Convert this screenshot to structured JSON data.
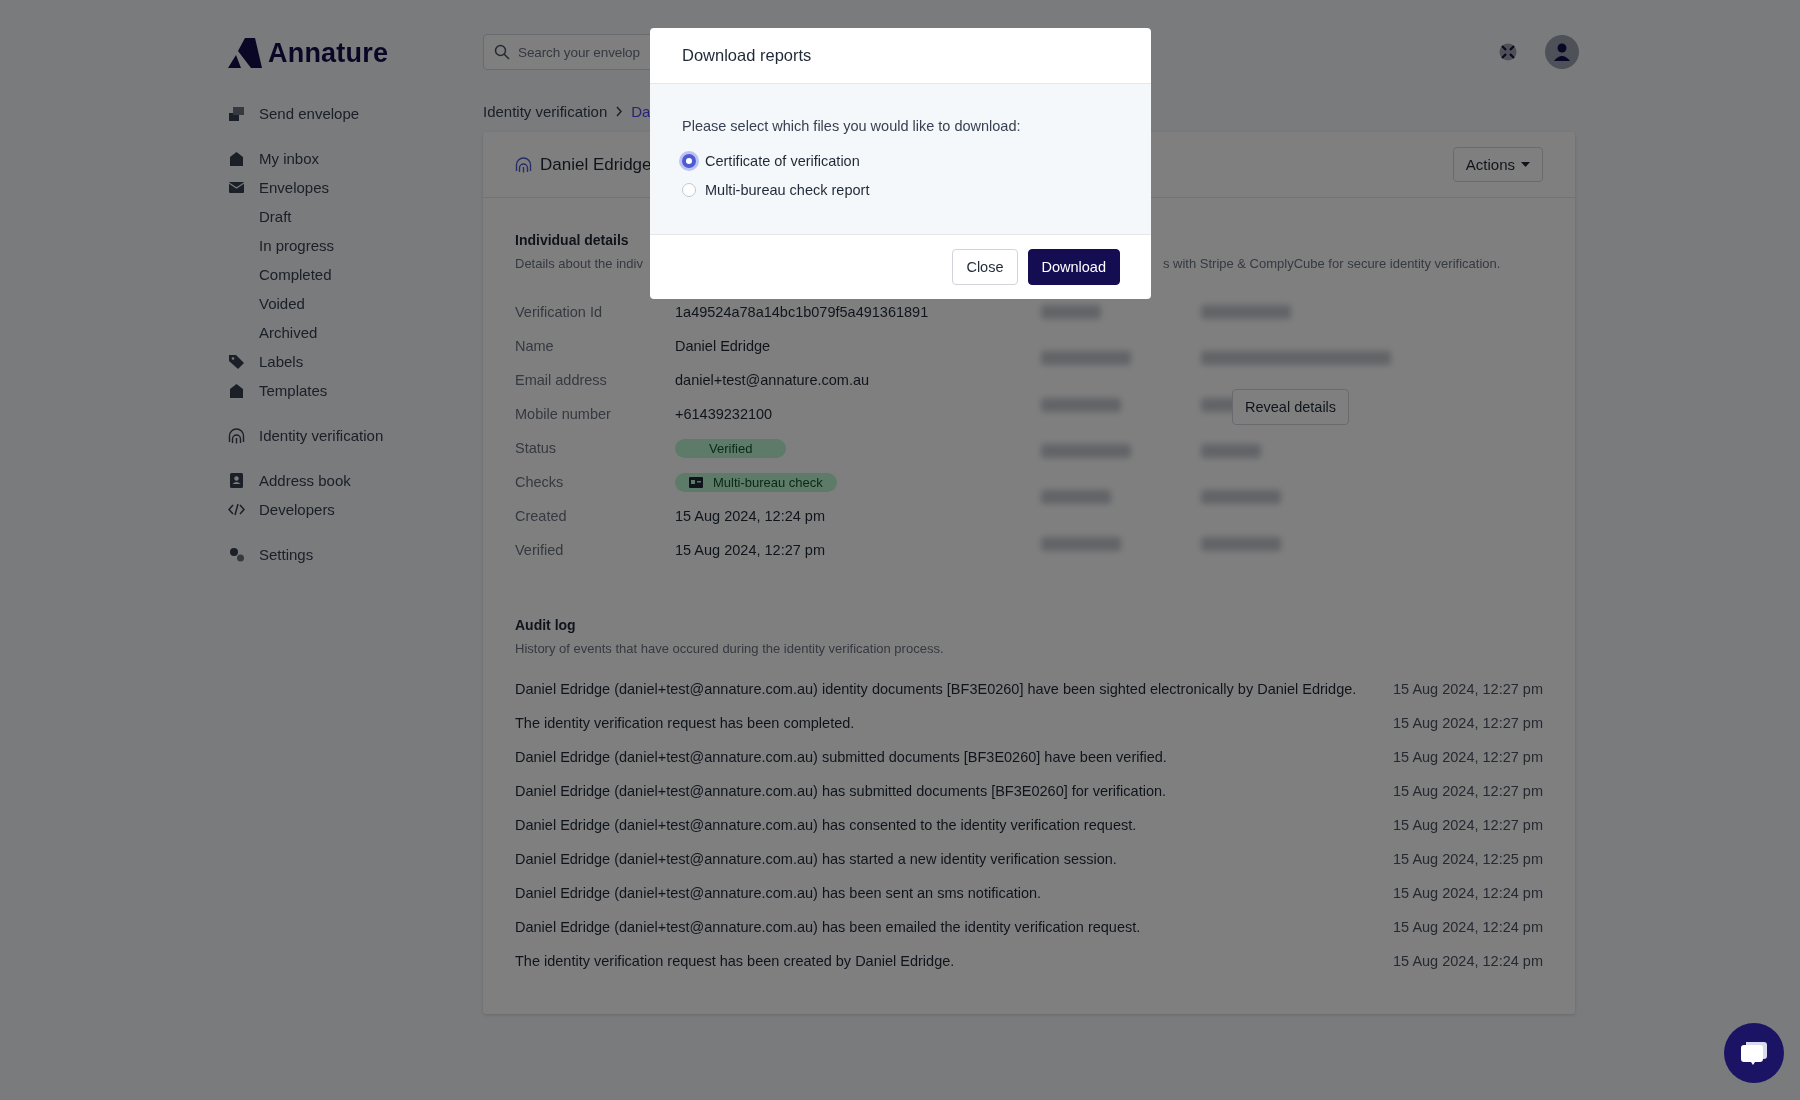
{
  "header": {
    "logo": "Annature",
    "search": {
      "placeholder": "Search your envelop"
    }
  },
  "sidebar": {
    "groups": [
      [
        {
          "label": "Send envelope"
        }
      ],
      [
        {
          "label": "My inbox"
        },
        {
          "label": "Envelopes",
          "children": [
            {
              "label": "Draft"
            },
            {
              "label": "In progress"
            },
            {
              "label": "Completed"
            },
            {
              "label": "Voided"
            },
            {
              "label": "Archived"
            }
          ]
        },
        {
          "label": "Labels"
        },
        {
          "label": "Templates"
        }
      ],
      [
        {
          "label": "Identity verification"
        }
      ],
      [
        {
          "label": "Address book"
        },
        {
          "label": "Developers"
        }
      ],
      [
        {
          "label": "Settings"
        }
      ]
    ]
  },
  "breadcrumb": [
    "Identity verification",
    "Da"
  ],
  "card": {
    "title": "Daniel Edridge",
    "actions_button": "Actions",
    "individual_details": {
      "heading": "Individual details",
      "description_left": "Details about the indiv",
      "description_right": "s with Stripe & ComplyCube for secure identity verification.",
      "fields": [
        {
          "label": "Verification Id",
          "value": "1a49524a78a14bc1b079f5a491361891",
          "kind": "text"
        },
        {
          "label": "Name",
          "value": "Daniel Edridge",
          "kind": "text"
        },
        {
          "label": "Email address",
          "value": "daniel+test@annature.com.au",
          "kind": "text"
        },
        {
          "label": "Mobile number",
          "value": "+61439232100",
          "kind": "text"
        },
        {
          "label": "Status",
          "value": "Verified",
          "kind": "badge"
        },
        {
          "label": "Checks",
          "value": "Multi-bureau check",
          "kind": "check-badge"
        },
        {
          "label": "Created",
          "value": "15 Aug 2024, 12:24 pm",
          "kind": "text"
        },
        {
          "label": "Verified",
          "value": "15 Aug 2024, 12:27 pm",
          "kind": "text"
        }
      ],
      "reveal_button": "Reveal details"
    },
    "audit_log": {
      "heading": "Audit log",
      "description": "History of events that have occured during the identity verification process.",
      "rows": [
        {
          "event": "Daniel Edridge (daniel+test@annature.com.au) identity documents [BF3E0260] have been sighted electronically by Daniel Edridge.",
          "time": "15 Aug 2024, 12:27 pm"
        },
        {
          "event": "The identity verification request has been completed.",
          "time": "15 Aug 2024, 12:27 pm"
        },
        {
          "event": "Daniel Edridge (daniel+test@annature.com.au) submitted documents [BF3E0260] have been verified.",
          "time": "15 Aug 2024, 12:27 pm"
        },
        {
          "event": "Daniel Edridge (daniel+test@annature.com.au) has submitted documents [BF3E0260] for verification.",
          "time": "15 Aug 2024, 12:27 pm"
        },
        {
          "event": "Daniel Edridge (daniel+test@annature.com.au) has consented to the identity verification request.",
          "time": "15 Aug 2024, 12:27 pm"
        },
        {
          "event": "Daniel Edridge (daniel+test@annature.com.au) has started a new identity verification session.",
          "time": "15 Aug 2024, 12:25 pm"
        },
        {
          "event": "Daniel Edridge (daniel+test@annature.com.au) has been sent an sms notification.",
          "time": "15 Aug 2024, 12:24 pm"
        },
        {
          "event": "Daniel Edridge (daniel+test@annature.com.au) has been emailed the identity verification request.",
          "time": "15 Aug 2024, 12:24 pm"
        },
        {
          "event": "The identity verification request has been created by Daniel Edridge.",
          "time": "15 Aug 2024, 12:24 pm"
        }
      ]
    }
  },
  "modal": {
    "title": "Download reports",
    "prompt": "Please select which files you would like to download:",
    "options": [
      {
        "label": "Certificate of verification",
        "selected": true
      },
      {
        "label": "Multi-bureau check report",
        "selected": false
      }
    ],
    "buttons": [
      {
        "label": "Close",
        "kind": "secondary"
      },
      {
        "label": "Download",
        "kind": "primary"
      }
    ]
  }
}
